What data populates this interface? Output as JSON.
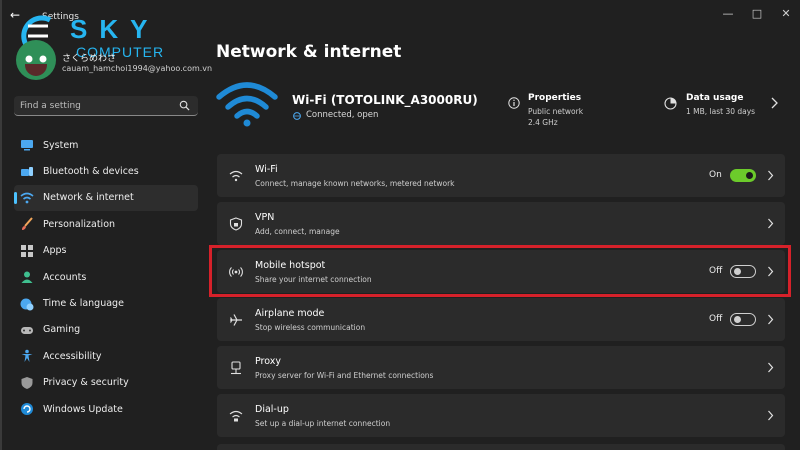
{
  "window": {
    "title": "Settings"
  },
  "logo": {
    "line1": "SKY",
    "line2": "COMPUTER"
  },
  "profile": {
    "name": "さくらめわさ",
    "email": "cauam_hamchoi1994@yahoo.com.vn"
  },
  "search": {
    "placeholder": "Find a setting"
  },
  "sidebar": {
    "items": [
      {
        "label": "System",
        "icon": "monitor-icon"
      },
      {
        "label": "Bluetooth & devices",
        "icon": "bluetooth-icon"
      },
      {
        "label": "Network & internet",
        "icon": "wifi-icon",
        "active": true
      },
      {
        "label": "Personalization",
        "icon": "brush-icon"
      },
      {
        "label": "Apps",
        "icon": "apps-icon"
      },
      {
        "label": "Accounts",
        "icon": "person-icon"
      },
      {
        "label": "Time & language",
        "icon": "globe-clock-icon"
      },
      {
        "label": "Gaming",
        "icon": "gamepad-icon"
      },
      {
        "label": "Accessibility",
        "icon": "accessibility-icon"
      },
      {
        "label": "Privacy & security",
        "icon": "shield-icon"
      },
      {
        "label": "Windows Update",
        "icon": "update-icon"
      }
    ]
  },
  "main": {
    "title": "Network & internet",
    "connection": {
      "name": "Wi-Fi (TOTOLINK_A3000RU)",
      "status": "Connected, open"
    },
    "properties": {
      "title": "Properties",
      "line1": "Public network",
      "line2": "2.4 GHz"
    },
    "data_usage": {
      "title": "Data usage",
      "detail": "1 MB, last 30 days"
    },
    "settings": [
      {
        "title": "Wi-Fi",
        "subtitle": "Connect, manage known networks, metered network",
        "icon": "wifi-icon",
        "state": "On",
        "toggle": "on"
      },
      {
        "title": "VPN",
        "subtitle": "Add, connect, manage",
        "icon": "vpn-shield-icon"
      },
      {
        "title": "Mobile hotspot",
        "subtitle": "Share your internet connection",
        "icon": "hotspot-icon",
        "state": "Off",
        "toggle": "off",
        "highlighted": true
      },
      {
        "title": "Airplane mode",
        "subtitle": "Stop wireless communication",
        "icon": "airplane-icon",
        "state": "Off",
        "toggle": "off"
      },
      {
        "title": "Proxy",
        "subtitle": "Proxy server for Wi-Fi and Ethernet connections",
        "icon": "proxy-icon"
      },
      {
        "title": "Dial-up",
        "subtitle": "Set up a dial-up internet connection",
        "icon": "dialup-icon"
      }
    ]
  },
  "colors": {
    "accent": "#4cc2ff",
    "toggle_on": "#6ccb2b",
    "highlight": "#d6212a",
    "logo": "#26b5f0"
  }
}
